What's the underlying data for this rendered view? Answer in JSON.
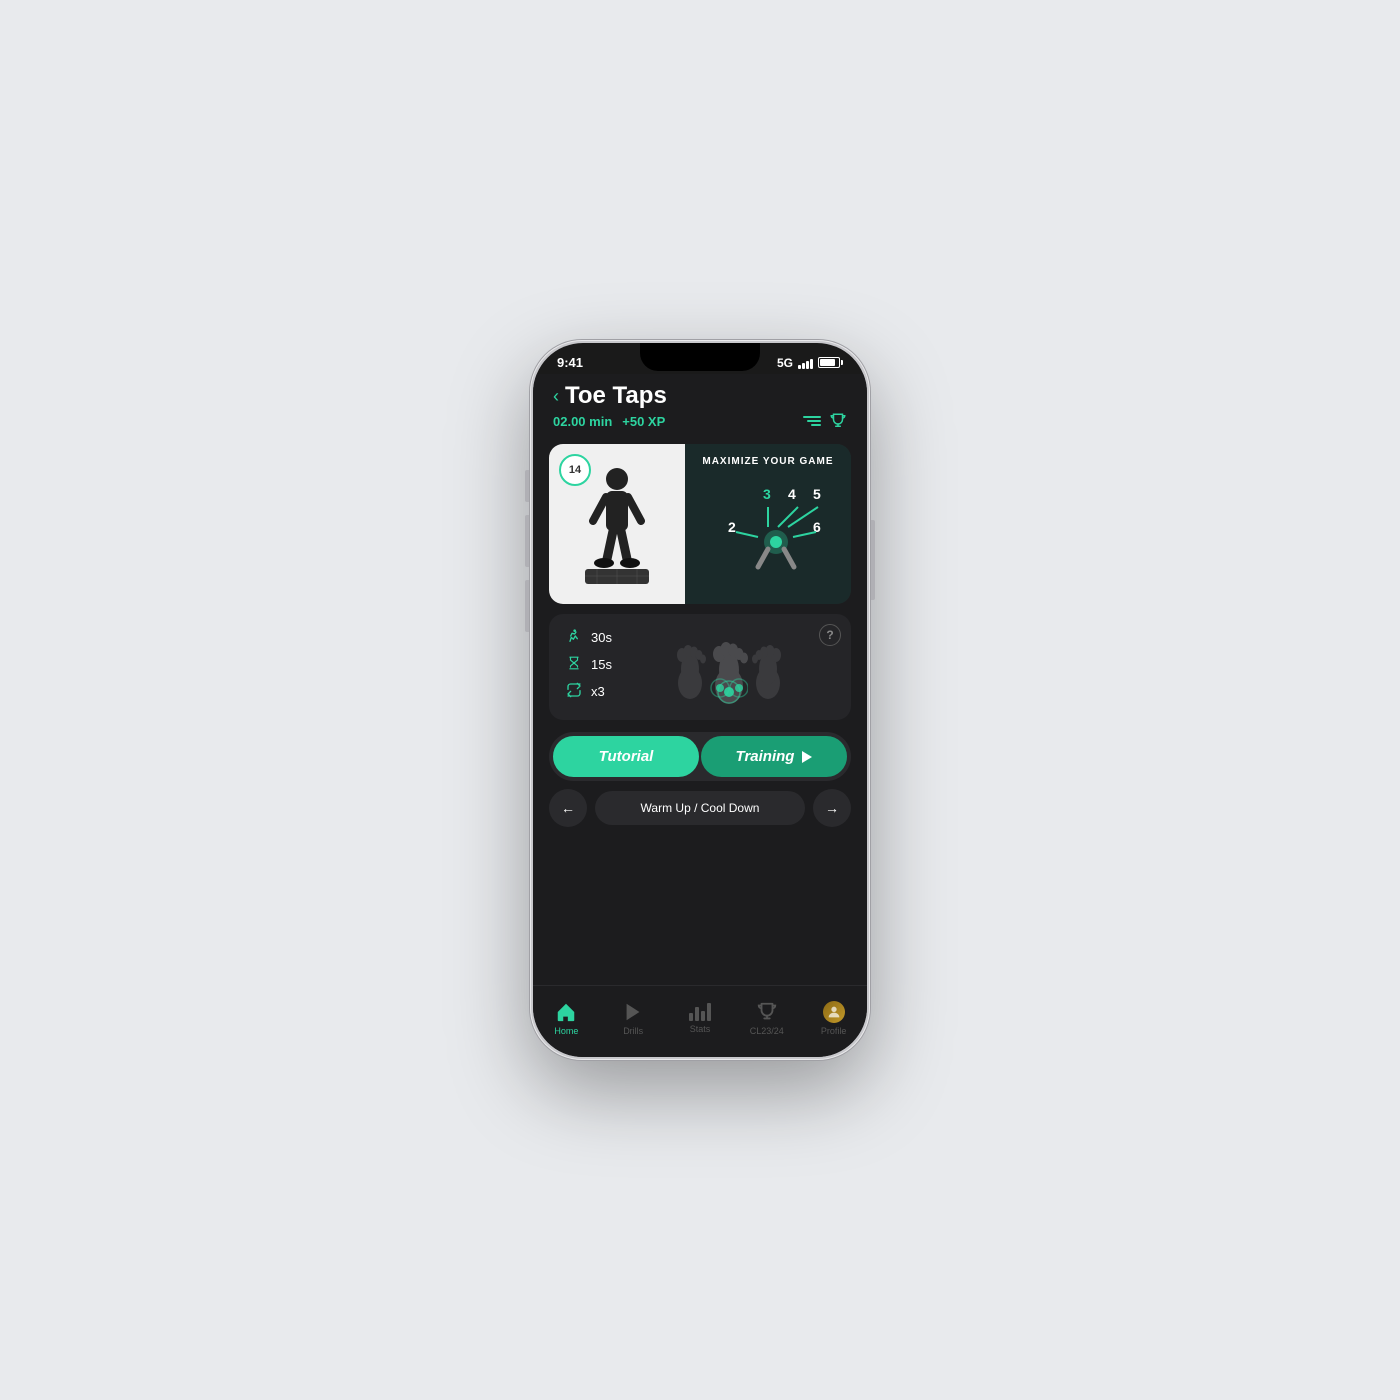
{
  "status": {
    "time": "9:41",
    "network": "5G"
  },
  "header": {
    "back_label": "‹",
    "title": "Toe Taps",
    "duration": "02.00 min",
    "xp": "+50 XP"
  },
  "exercise": {
    "duration_label": "30s",
    "rest_label": "15s",
    "sets_label": "x3",
    "timer_number": "14",
    "video_title": "MAXIMIZE YOUR GAME"
  },
  "buttons": {
    "tutorial_label": "Tutorial",
    "training_label": "Training"
  },
  "navigation": {
    "back_arrow": "←",
    "forward_arrow": "→",
    "center_label": "Warm Up / Cool Down"
  },
  "tabs": [
    {
      "id": "home",
      "label": "Home",
      "active": true
    },
    {
      "id": "drills",
      "label": "Drills",
      "active": false
    },
    {
      "id": "stats",
      "label": "Stats",
      "active": false
    },
    {
      "id": "cl",
      "label": "CL23/24",
      "active": false
    },
    {
      "id": "profile",
      "label": "Profile",
      "active": false
    }
  ],
  "help_button_label": "?"
}
